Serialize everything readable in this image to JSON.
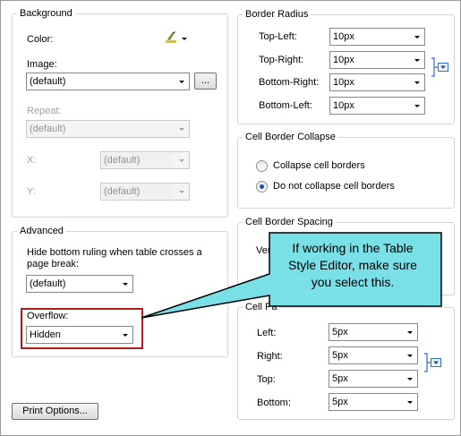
{
  "background": {
    "legend": "Background",
    "color_label": "Color:",
    "image_label": "Image:",
    "image_value": "(default)",
    "browse_label": "...",
    "repeat_label": "Repeat:",
    "repeat_value": "(default)",
    "x_label": "X:",
    "x_value": "(default)",
    "y_label": "Y:",
    "y_value": "(default)"
  },
  "advanced": {
    "legend": "Advanced",
    "ruling_label_line1": "Hide bottom ruling when table crosses a",
    "ruling_label_line2": "page break:",
    "ruling_value": "(default)",
    "overflow_label": "Overflow:",
    "overflow_value": "Hidden"
  },
  "print_options_label": "Print Options...",
  "border_radius": {
    "legend": "Border Radius",
    "rows": [
      {
        "label": "Top-Left:",
        "value": "10px"
      },
      {
        "label": "Top-Right:",
        "value": "10px"
      },
      {
        "label": "Bottom-Right:",
        "value": "10px"
      },
      {
        "label": "Bottom-Left:",
        "value": "10px"
      }
    ]
  },
  "cell_border_collapse": {
    "legend": "Cell Border Collapse",
    "option_collapse": "Collapse cell borders",
    "option_no_collapse": "Do not collapse cell borders",
    "selected": "option_no_collapse"
  },
  "cell_border_spacing": {
    "legend": "Cell Border Spacing",
    "partial_label": "Verti"
  },
  "cell_padding": {
    "legend": "Cell Pa",
    "rows": [
      {
        "label": "Left:",
        "value": "5px"
      },
      {
        "label": "Right:",
        "value": "5px"
      },
      {
        "label": "Top:",
        "value": "5px"
      },
      {
        "label": "Bottom:",
        "value": "5px"
      }
    ]
  },
  "callout": {
    "text": "If working in the Table Style Editor, make sure you select this."
  },
  "colors": {
    "callout_fill": "#78e0e6",
    "callout_border": "#000000",
    "highlight_border": "#b01c1c",
    "group_border": "#d5d5d5"
  }
}
